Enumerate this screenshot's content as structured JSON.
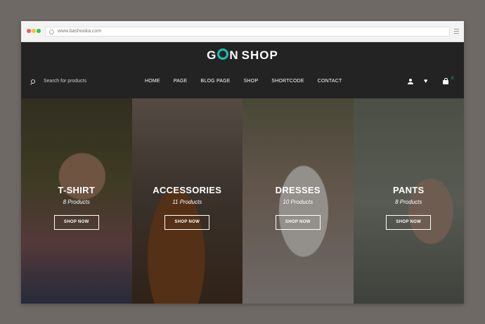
{
  "browser": {
    "url": "www.bashooka.com"
  },
  "header": {
    "logo": {
      "part1": "G",
      "part2": "N",
      "part3": "SHOP"
    },
    "search_placeholder": "Search for products",
    "nav": [
      "HOME",
      "PAGE",
      "BLOG PAGE",
      "SHOP",
      "SHORTCODE",
      "CONTACT"
    ],
    "cart_count": "0"
  },
  "categories": [
    {
      "name": "T-SHIRT",
      "count": "8 Products",
      "button": "SHOP NOW"
    },
    {
      "name": "ACCESSORIES",
      "count": "11 Products",
      "button": "SHOP NOW"
    },
    {
      "name": "DRESSES",
      "count": "10 Products",
      "button": "SHOP NOW"
    },
    {
      "name": "PANTS",
      "count": "8 Products",
      "button": "SHOP NOW"
    }
  ],
  "colors": {
    "accent": "#18c1b1",
    "header_bg": "#232323",
    "page_bg": "#6e6965"
  },
  "icons": [
    "search-icon",
    "user-icon",
    "heart-icon",
    "bag-icon"
  ]
}
